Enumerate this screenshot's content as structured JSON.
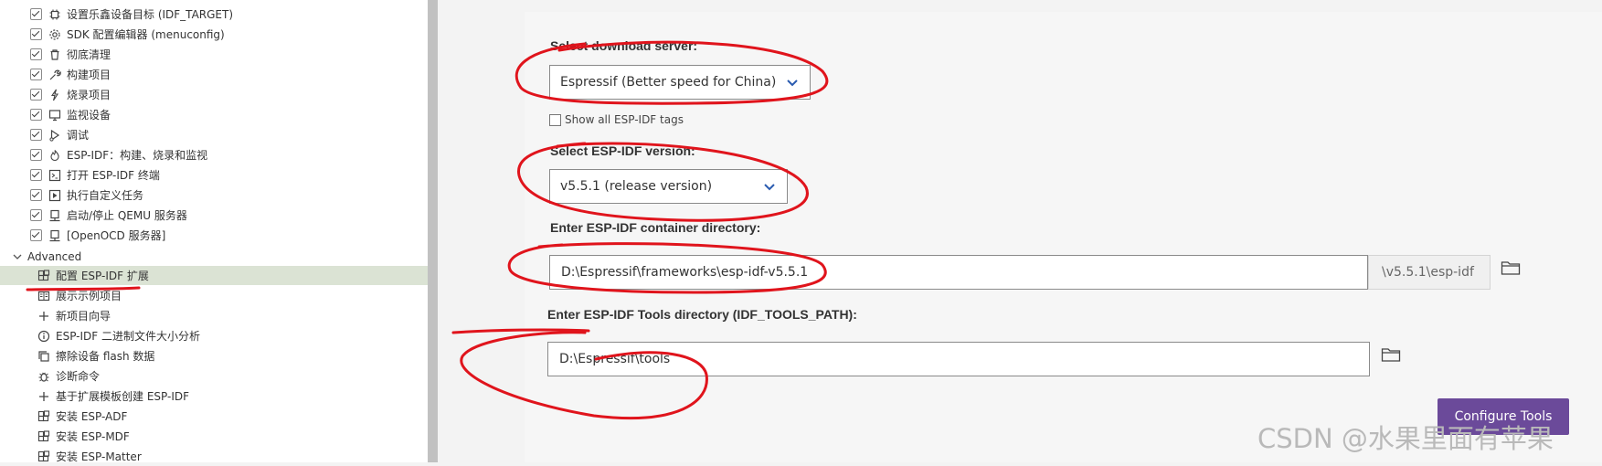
{
  "sidebar": {
    "checked_items": [
      {
        "label": "设置乐鑫设备目标 (IDF_TARGET)",
        "icon": "chip-icon"
      },
      {
        "label": "SDK 配置编辑器 (menuconfig)",
        "icon": "gear-icon"
      },
      {
        "label": "彻底清理",
        "icon": "trash-icon"
      },
      {
        "label": "构建项目",
        "icon": "wrench-icon"
      },
      {
        "label": "烧录项目",
        "icon": "lightning-icon"
      },
      {
        "label": "监视设备",
        "icon": "monitor-icon"
      },
      {
        "label": "调试",
        "icon": "debug-icon"
      },
      {
        "label": "ESP-IDF：构建、烧录和监视",
        "icon": "flame-icon"
      },
      {
        "label": "打开 ESP-IDF 终端",
        "icon": "terminal-icon"
      },
      {
        "label": "执行自定义任务",
        "icon": "run-icon"
      },
      {
        "label": "启动/停止 QEMU 服务器",
        "icon": "server-icon"
      },
      {
        "label": "[OpenOCD 服务器]",
        "icon": "server-icon"
      }
    ],
    "section_label": "Advanced",
    "advanced_items": [
      {
        "label": "配置 ESP-IDF 扩展",
        "icon": "extensions-icon"
      },
      {
        "label": "展示示例项目",
        "icon": "book-icon"
      },
      {
        "label": "新项目向导",
        "icon": "plus-icon"
      },
      {
        "label": "ESP-IDF 二进制文件大小分析",
        "icon": "info-icon"
      },
      {
        "label": "擦除设备 flash 数据",
        "icon": "copy-icon"
      },
      {
        "label": "诊断命令",
        "icon": "bug-icon"
      },
      {
        "label": "基于扩展模板创建 ESP-IDF",
        "icon": "plus-icon"
      },
      {
        "label": "安装 ESP-ADF",
        "icon": "extensions-icon"
      },
      {
        "label": "安装 ESP-MDF",
        "icon": "extensions-icon"
      },
      {
        "label": "安装 ESP-Matter",
        "icon": "extensions-icon"
      }
    ]
  },
  "form": {
    "download_server_label": "Select download server:",
    "download_server_value": "Espressif (Better speed for China)",
    "show_all_tags_label": "Show all ESP-IDF tags",
    "version_label": "Select ESP-IDF version:",
    "version_value": "v5.5.1 (release version)",
    "container_dir_label": "Enter ESP-IDF container directory:",
    "container_dir_value": "D:\\Espressif\\frameworks\\esp-idf-v5.5.1",
    "container_dir_suffix": "\\v5.5.1\\esp-idf",
    "tools_dir_label": "Enter ESP-IDF Tools directory (IDF_TOOLS_PATH):",
    "tools_dir_value": "D:\\Espressif\\tools",
    "configure_button": "Configure Tools"
  },
  "watermark": "CSDN @水果里面有苹果",
  "colors": {
    "accent_button": "#6b4a9a",
    "annotation": "#e0141c",
    "selected_row": "#dbe3d4"
  }
}
